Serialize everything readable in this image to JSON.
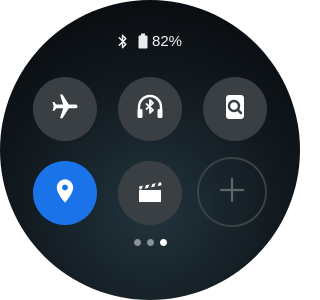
{
  "status_bar": {
    "battery_text": "82%",
    "icons": [
      "bluetooth-icon",
      "battery-icon"
    ]
  },
  "tiles": [
    {
      "icon": "airplane-icon",
      "state": "off"
    },
    {
      "icon": "bluetooth-headphones-icon",
      "state": "off"
    },
    {
      "icon": "find-phone-icon",
      "state": "off"
    },
    {
      "icon": "location-icon",
      "state": "on"
    },
    {
      "icon": "theater-mode-icon",
      "state": "off"
    },
    {
      "icon": "add-icon",
      "state": "empty"
    }
  ],
  "page_indicator": {
    "total": 3,
    "current": 3
  },
  "colors": {
    "tile_off": "#3a3f44",
    "tile_on": "#1a73e8",
    "icon": "#ffffff"
  }
}
